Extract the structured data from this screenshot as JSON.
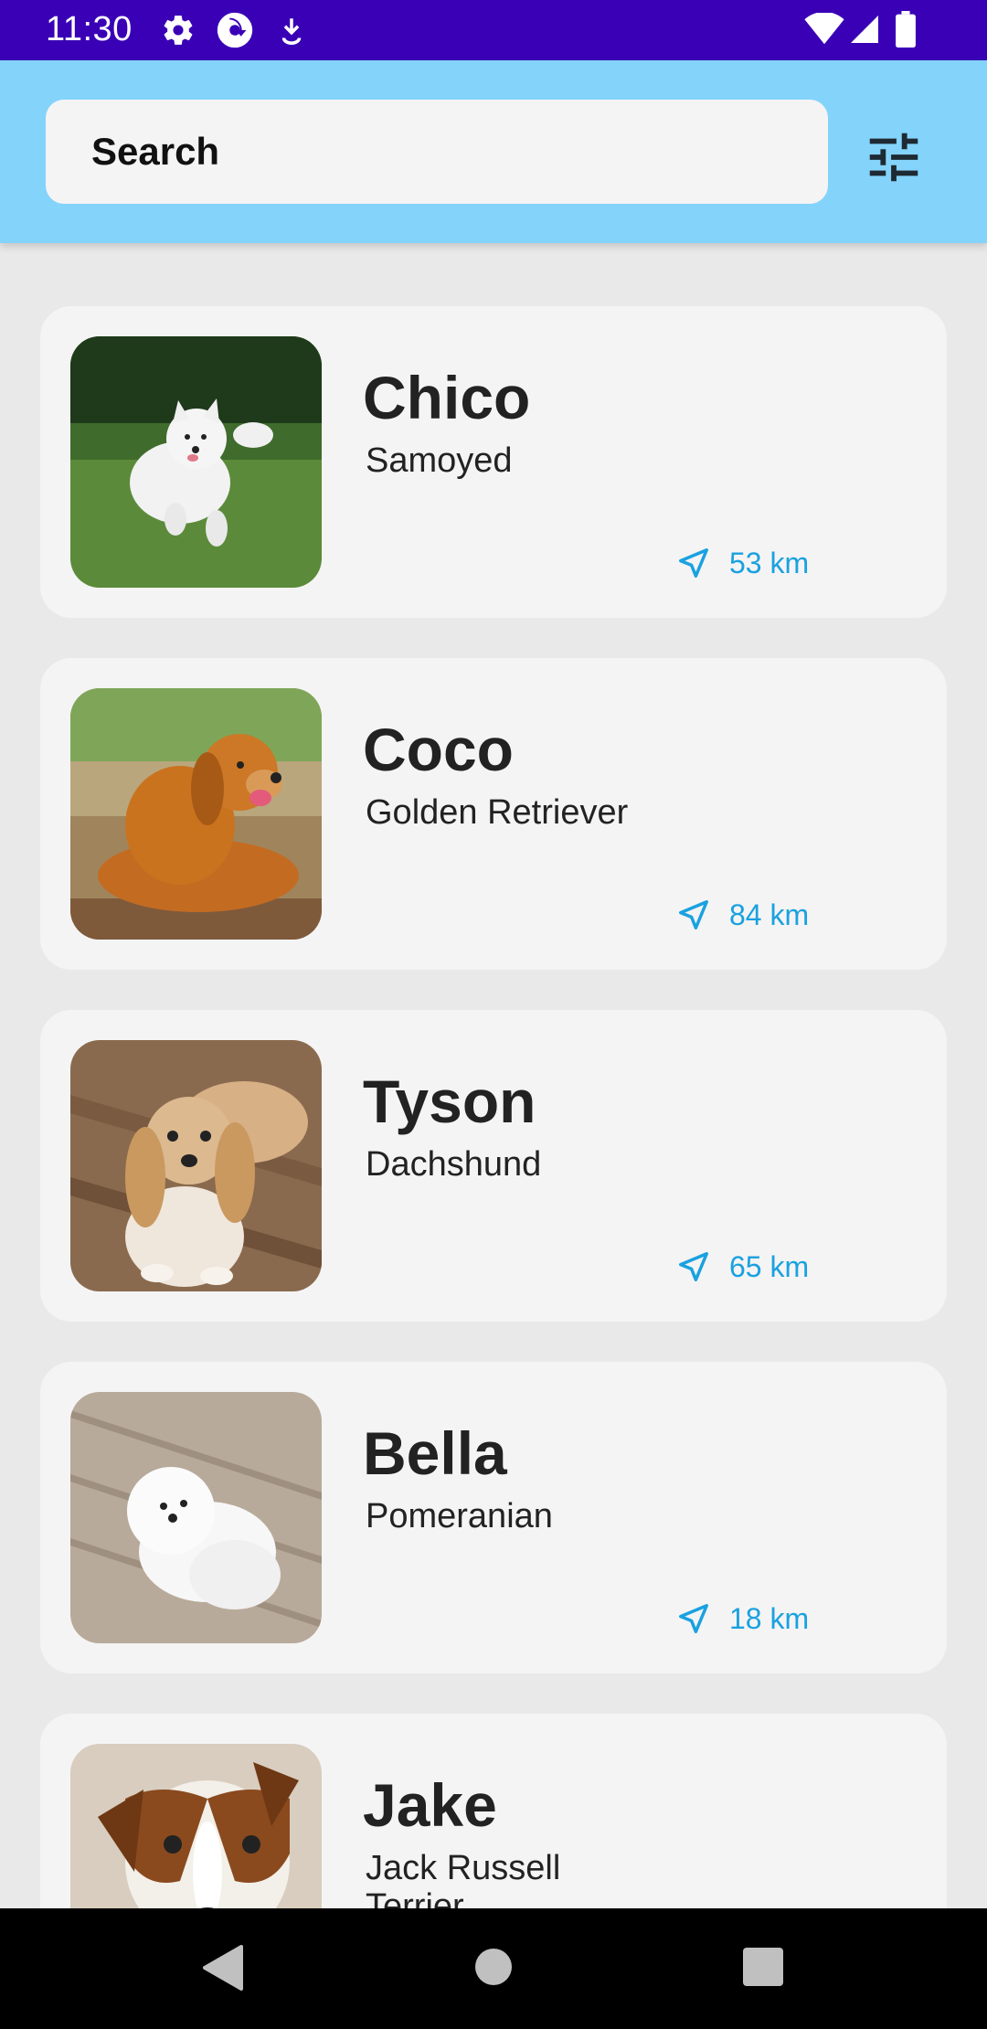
{
  "status_bar": {
    "time": "11:30",
    "icons": [
      "gear-icon",
      "sync-icon",
      "download-icon",
      "wifi-icon",
      "signal-icon",
      "battery-icon"
    ]
  },
  "search": {
    "placeholder": "Search"
  },
  "filter_icon": "tune-icon",
  "colors": {
    "status_bar": "#3a00b6",
    "app_bar": "#84d3fa",
    "distance": "#1aa1e0",
    "background": "#e9e9e9",
    "card": "#f4f4f4"
  },
  "dogs": [
    {
      "name": "Chico",
      "breed": "Samoyed",
      "distance": "53 km"
    },
    {
      "name": "Coco",
      "breed": "Golden Retriever",
      "distance": "84 km"
    },
    {
      "name": "Tyson",
      "breed": "Dachshund",
      "distance": "65 km"
    },
    {
      "name": "Bella",
      "breed": "Pomeranian",
      "distance": "18 km"
    },
    {
      "name": "Jake",
      "breed": "Jack Russell Terrier",
      "distance": ""
    }
  ],
  "nav": {
    "icons": [
      "back-icon",
      "home-icon",
      "recents-icon"
    ]
  }
}
